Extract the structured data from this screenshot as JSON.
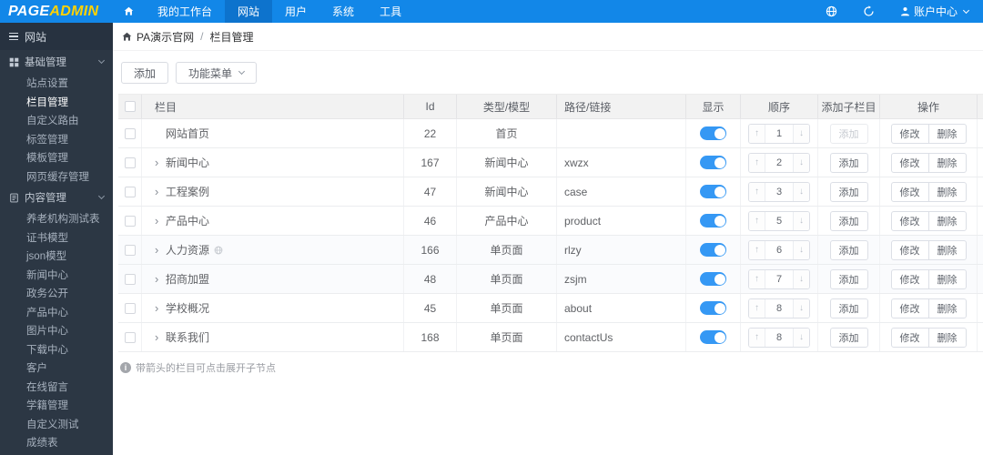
{
  "navbar": {
    "logo_part1": "PAGE",
    "logo_part2": "ADMIN",
    "items": [
      {
        "label": "我的工作台",
        "active": false
      },
      {
        "label": "网站",
        "active": true
      },
      {
        "label": "用户",
        "active": false
      },
      {
        "label": "系统",
        "active": false
      },
      {
        "label": "工具",
        "active": false
      }
    ],
    "account_label": "账户中心"
  },
  "sidebar": {
    "title": "网站",
    "groups": [
      {
        "label": "基础管理",
        "icon": "grid-icon",
        "items": [
          {
            "label": "站点设置",
            "active": false
          },
          {
            "label": "栏目管理",
            "active": true
          },
          {
            "label": "自定义路由",
            "active": false
          },
          {
            "label": "标签管理",
            "active": false
          },
          {
            "label": "模板管理",
            "active": false
          },
          {
            "label": "网页缓存管理",
            "active": false
          }
        ]
      },
      {
        "label": "内容管理",
        "icon": "document-icon",
        "items": [
          {
            "label": "养老机构测试表",
            "active": false
          },
          {
            "label": "证书模型",
            "active": false
          },
          {
            "label": "json模型",
            "active": false
          },
          {
            "label": "新闻中心",
            "active": false
          },
          {
            "label": "政务公开",
            "active": false
          },
          {
            "label": "产品中心",
            "active": false
          },
          {
            "label": "图片中心",
            "active": false
          },
          {
            "label": "下载中心",
            "active": false
          },
          {
            "label": "客户",
            "active": false
          },
          {
            "label": "在线留言",
            "active": false
          },
          {
            "label": "学籍管理",
            "active": false
          },
          {
            "label": "自定义测试",
            "active": false
          },
          {
            "label": "成绩表",
            "active": false
          }
        ]
      }
    ]
  },
  "breadcrumb": {
    "site": "PA演示官网",
    "separator": "/",
    "current": "栏目管理"
  },
  "toolbar": {
    "add_label": "添加",
    "menu_label": "功能菜单"
  },
  "table": {
    "columns": {
      "name": "栏目",
      "id": "Id",
      "type": "类型/模型",
      "path": "路径/链接",
      "visible": "显示",
      "order": "顺序",
      "add_child": "添加子栏目",
      "actions": "操作"
    },
    "buttons": {
      "add_child": "添加",
      "edit": "修改",
      "delete": "删除"
    },
    "rows": [
      {
        "name": "网站首页",
        "expandable": false,
        "id": "22",
        "type": "首页",
        "path": "",
        "visible": true,
        "order": "1",
        "add_disabled": true,
        "link_icon": false,
        "shaded": false
      },
      {
        "name": "新闻中心",
        "expandable": true,
        "id": "167",
        "type": "新闻中心",
        "path": "xwzx",
        "visible": true,
        "order": "2",
        "add_disabled": false,
        "link_icon": false,
        "shaded": false
      },
      {
        "name": "工程案例",
        "expandable": true,
        "id": "47",
        "type": "新闻中心",
        "path": "case",
        "visible": true,
        "order": "3",
        "add_disabled": false,
        "link_icon": false,
        "shaded": false
      },
      {
        "name": "产品中心",
        "expandable": true,
        "id": "46",
        "type": "产品中心",
        "path": "product",
        "visible": true,
        "order": "5",
        "add_disabled": false,
        "link_icon": false,
        "shaded": false
      },
      {
        "name": "人力资源",
        "expandable": true,
        "id": "166",
        "type": "单页面",
        "path": "rlzy",
        "visible": true,
        "order": "6",
        "add_disabled": false,
        "link_icon": true,
        "shaded": true
      },
      {
        "name": "招商加盟",
        "expandable": true,
        "id": "48",
        "type": "单页面",
        "path": "zsjm",
        "visible": true,
        "order": "7",
        "add_disabled": false,
        "link_icon": false,
        "shaded": true
      },
      {
        "name": "学校概况",
        "expandable": true,
        "id": "45",
        "type": "单页面",
        "path": "about",
        "visible": true,
        "order": "8",
        "add_disabled": false,
        "link_icon": false,
        "shaded": false
      },
      {
        "name": "联系我们",
        "expandable": true,
        "id": "168",
        "type": "单页面",
        "path": "contactUs",
        "visible": true,
        "order": "8",
        "add_disabled": false,
        "link_icon": false,
        "shaded": false
      }
    ]
  },
  "footer_note": "带箭头的栏目可点击展开子节点",
  "colors": {
    "navbar": "#1287e8",
    "navbar_active": "#0d73cd",
    "logo_accent": "#ffd200",
    "sidebar_bg": "#2c3744",
    "toggle_on": "#3598f4"
  }
}
